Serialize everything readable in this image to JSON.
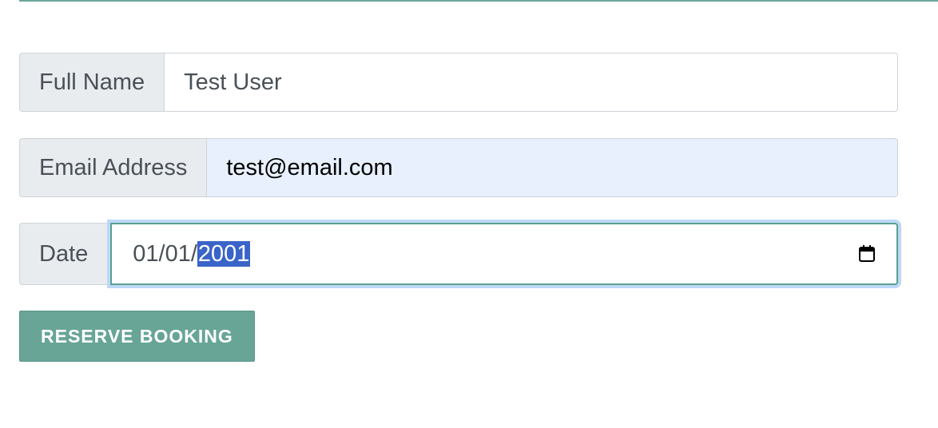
{
  "form": {
    "name": {
      "label": "Full Name",
      "value": "Test User"
    },
    "email": {
      "label": "Email Address",
      "value": "test@email.com"
    },
    "date": {
      "label": "Date",
      "prefix": "01/01/",
      "selected": "2001"
    },
    "submit_label": "RESERVE BOOKING"
  },
  "icons": {
    "date_picker": "calendar-icon"
  },
  "colors": {
    "accent": "#68a597",
    "selection": "#3a64c8",
    "autofill": "#e8f0fe"
  }
}
